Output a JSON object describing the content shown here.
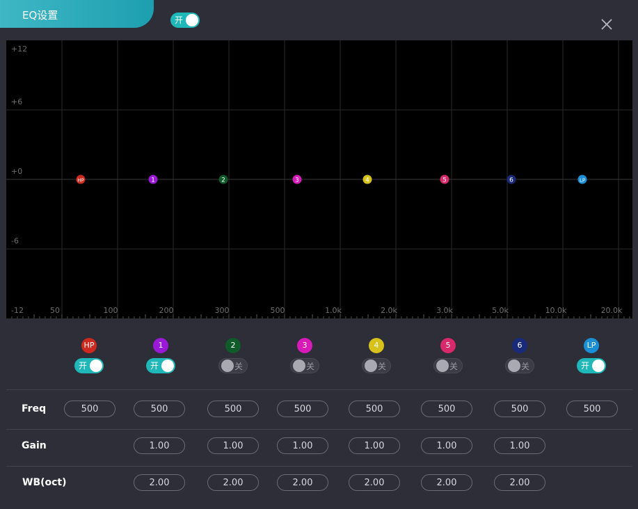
{
  "window": {
    "title": "EQ设置",
    "master_toggle_label": "开"
  },
  "graph": {
    "y_ticks": [
      "+12",
      "+6",
      "+0",
      "-6",
      "-12"
    ],
    "x_ticks": [
      "50",
      "100",
      "200",
      "300",
      "500",
      "1.0k",
      "2.0k",
      "3.0k",
      "5.0k",
      "10.0k",
      "20.0k"
    ],
    "grid_color": "#2a2a2a",
    "label_color": "#6e6e6e"
  },
  "bands": [
    {
      "name": "HP",
      "color": "#cc2a1f",
      "toggle": "开",
      "state": "on"
    },
    {
      "name": "1",
      "color": "#9a19d6",
      "toggle": "开",
      "state": "on"
    },
    {
      "name": "2",
      "color": "#0f5b2a",
      "toggle": "关",
      "state": "off"
    },
    {
      "name": "3",
      "color": "#d61bb8",
      "toggle": "关",
      "state": "off"
    },
    {
      "name": "4",
      "color": "#d6c21b",
      "toggle": "关",
      "state": "off"
    },
    {
      "name": "5",
      "color": "#d62a6a",
      "toggle": "关",
      "state": "off"
    },
    {
      "name": "6",
      "color": "#1a2a7a",
      "toggle": "关",
      "state": "off"
    },
    {
      "name": "LP",
      "color": "#1a8fd6",
      "toggle": "开",
      "state": "on"
    }
  ],
  "params": {
    "freq_label": "Freq",
    "gain_label": "Gain",
    "wb_label": "WB(oct)",
    "freq": [
      "500",
      "500",
      "500",
      "500",
      "500",
      "500",
      "500",
      "500"
    ],
    "gain": [
      "1.00",
      "1.00",
      "1.00",
      "1.00",
      "1.00",
      "1.00"
    ],
    "wb": [
      "2.00",
      "2.00",
      "2.00",
      "2.00",
      "2.00",
      "2.00"
    ]
  },
  "accent_color": "#1fb7b7"
}
